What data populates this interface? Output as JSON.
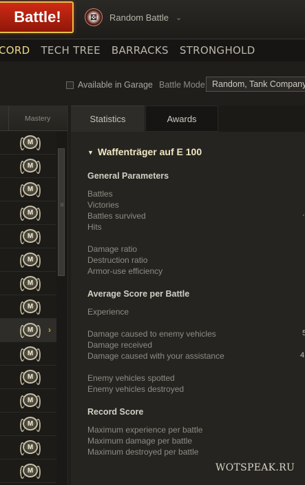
{
  "header": {
    "battle_button": "Battle!",
    "battle_mode": {
      "label": "Random Battle",
      "icon": "battle-mode-icon",
      "icon_glyph": "⚄"
    },
    "dropdown_chevron": "⌄"
  },
  "nav": {
    "tabs": [
      "CORD",
      "TECH TREE",
      "BARRACKS",
      "STRONGHOLD"
    ],
    "active_index": 0
  },
  "filter": {
    "available_in_garage_label": "Available in Garage",
    "available_in_garage_checked": false,
    "battle_mode_label": "Battle Mode:",
    "battle_mode_value": "Random, Tank Company"
  },
  "list": {
    "column_header": "Mastery",
    "mastery_badge": "M",
    "rows": [
      {
        "selected": false
      },
      {
        "selected": false
      },
      {
        "selected": false
      },
      {
        "selected": false
      },
      {
        "selected": false
      },
      {
        "selected": false
      },
      {
        "selected": false
      },
      {
        "selected": false
      },
      {
        "selected": true
      },
      {
        "selected": false
      },
      {
        "selected": false
      },
      {
        "selected": false
      },
      {
        "selected": false
      },
      {
        "selected": false
      },
      {
        "selected": false
      }
    ],
    "selected_arrow": "›",
    "scroll_grip": "≡"
  },
  "panel": {
    "tabs": [
      "Statistics",
      "Awards"
    ],
    "active_tab": 0,
    "vehicle_name": "Waffenträger auf E 100",
    "collapse_icon": "▼",
    "sections": [
      {
        "title": "General Parameters",
        "groups": [
          [
            "Battles",
            "Victories",
            "Battles survived",
            "Hits"
          ],
          [
            "Damage ratio",
            "Destruction ratio",
            "Armor-use efficiency"
          ]
        ]
      },
      {
        "title": "Average Score per Battle",
        "groups": [
          [
            "Experience"
          ],
          [
            "Damage caused to enemy vehicles",
            "Damage received",
            "Damage caused with your assistance"
          ],
          [
            "Enemy vehicles spotted",
            "Enemy vehicles destroyed"
          ]
        ]
      },
      {
        "title": "Record Score",
        "groups": [
          [
            "Maximum experience per battle",
            "Maximum damage per battle",
            "Maximum destroyed per battle"
          ]
        ]
      }
    ],
    "cut_values": {
      "battles_survived": "·",
      "damage_caused_to_enemy": "5",
      "assistance": "4"
    }
  },
  "watermark": "WOTSPEAK.RU"
}
